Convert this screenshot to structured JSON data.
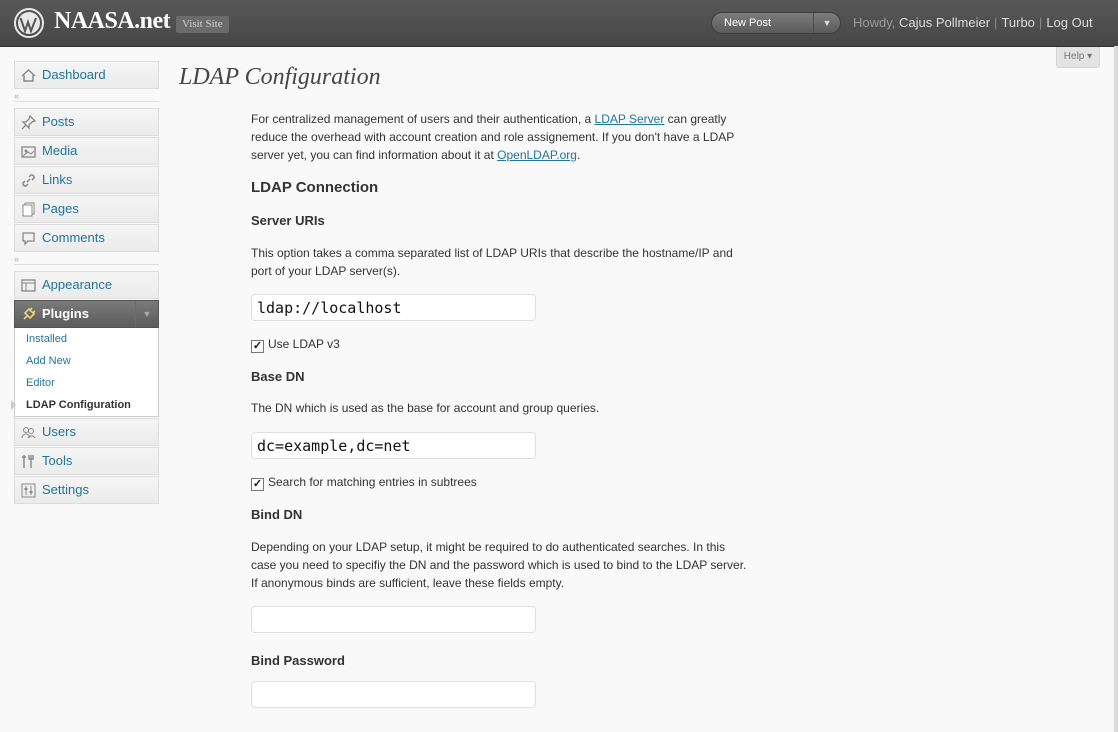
{
  "header": {
    "site_title": "NAASA.net",
    "visit_site": "Visit Site",
    "new_post": "New Post",
    "howdy": "Howdy, ",
    "user_name": "Cajus Pollmeier",
    "turbo": "Turbo",
    "logout": "Log Out",
    "separator": "|"
  },
  "help": {
    "label": "Help",
    "arrow": "▾"
  },
  "sidebar": {
    "collapse_glyph": "«",
    "toggle_glyph": "▼",
    "items": [
      {
        "label": "Dashboard",
        "icon": "dashboard-icon"
      },
      {
        "label": "Posts",
        "icon": "pushpin-icon"
      },
      {
        "label": "Media",
        "icon": "media-icon"
      },
      {
        "label": "Links",
        "icon": "link-icon"
      },
      {
        "label": "Pages",
        "icon": "pages-icon"
      },
      {
        "label": "Comments",
        "icon": "comment-icon"
      },
      {
        "label": "Appearance",
        "icon": "appearance-icon"
      },
      {
        "label": "Plugins",
        "icon": "plugin-icon"
      },
      {
        "label": "Users",
        "icon": "users-icon"
      },
      {
        "label": "Tools",
        "icon": "tools-icon"
      },
      {
        "label": "Settings",
        "icon": "settings-icon"
      }
    ],
    "plugins_submenu": [
      {
        "label": "Installed"
      },
      {
        "label": "Add New"
      },
      {
        "label": "Editor"
      },
      {
        "label": "LDAP Configuration"
      }
    ]
  },
  "page": {
    "title": "LDAP Configuration",
    "intro_1": "For centralized management of users and their authentication, a ",
    "intro_link1": "LDAP Server",
    "intro_2": " can greatly reduce the overhead with account creation and role assignement. If you don't have a LDAP server yet, you can find information about it at ",
    "intro_link2": "OpenLDAP.org",
    "intro_3": ".",
    "section_title": "LDAP Connection",
    "server_uris": {
      "label": "Server URIs",
      "desc": "This option takes a comma separated list of LDAP URIs that describe the hostname/IP and port of your LDAP server(s).",
      "value": "ldap://localhost"
    },
    "use_ldap_v3": {
      "label": "Use LDAP v3",
      "checked": true
    },
    "base_dn": {
      "label": "Base DN",
      "desc": "The DN which is used as the base for account and group queries.",
      "value": "dc=example,dc=net"
    },
    "subtree_search": {
      "label": "Search for matching entries in subtrees",
      "checked": true
    },
    "bind_dn": {
      "label": "Bind DN",
      "desc": "Depending on your LDAP setup, it might be required to do authenticated searches. In this case you need to specifiy the DN and the password which is used to bind to the LDAP server. If anonymous binds are sufficient, leave these fields empty.",
      "value": ""
    },
    "bind_password": {
      "label": "Bind Password",
      "value": ""
    },
    "check_glyph": "✓"
  }
}
